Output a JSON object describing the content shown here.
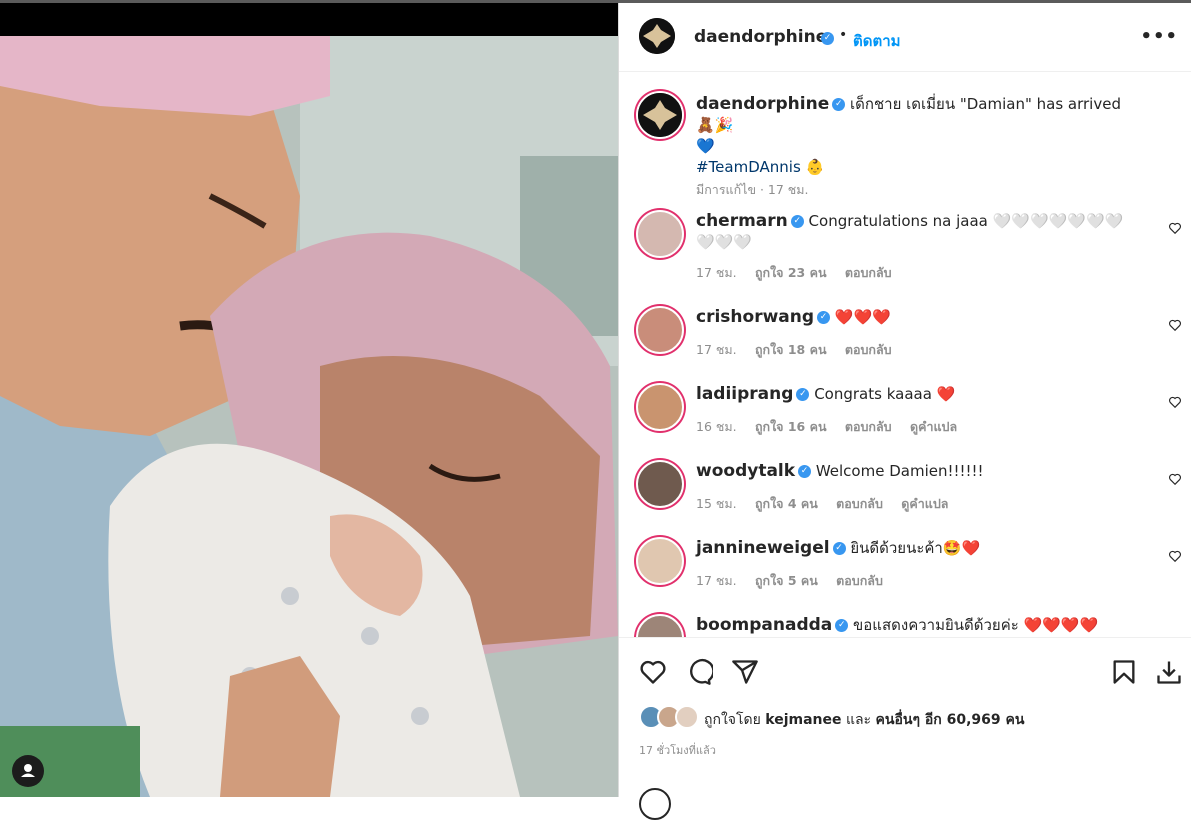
{
  "post": {
    "owner": "daendorphine",
    "follow_label": "ติดตาม",
    "more_label": "•••",
    "dot": "•"
  },
  "caption": {
    "username": "daendorphine",
    "text": "เด็กชาย เดเมี่ยน \"Damian\" has arrived 🧸🎉",
    "text_line2": "💙",
    "hashtag": "#TeamDAnnis",
    "hashtag_emoji": "👶",
    "meta": "มีการแก้ไข · 17 ชม."
  },
  "comments": [
    {
      "username": "chermarn",
      "text": "Congratulations na jaaa 🤍🤍🤍🤍🤍🤍🤍",
      "text2": "🤍🤍🤍",
      "time": "17 ชม.",
      "likes": "ถูกใจ 23 คน",
      "reply": "ตอบกลับ",
      "translate": ""
    },
    {
      "username": "crishorwang",
      "text": "❤️❤️❤️",
      "text2": "",
      "time": "17 ชม.",
      "likes": "ถูกใจ 18 คน",
      "reply": "ตอบกลับ",
      "translate": ""
    },
    {
      "username": "ladiiprang",
      "text": "Congrats kaaaa ❤️",
      "text2": "",
      "time": "16 ชม.",
      "likes": "ถูกใจ 16 คน",
      "reply": "ตอบกลับ",
      "translate": "ดูคำแปล"
    },
    {
      "username": "woodytalk",
      "text": "Welcome Damien!!!!!!",
      "text2": "",
      "time": "15 ชม.",
      "likes": "ถูกใจ 4 คน",
      "reply": "ตอบกลับ",
      "translate": "ดูคำแปล"
    },
    {
      "username": "jannineweigel",
      "text": "ยินดีด้วยนะค้า🤩❤️",
      "text2": "",
      "time": "17 ชม.",
      "likes": "ถูกใจ 5 คน",
      "reply": "ตอบกลับ",
      "translate": ""
    },
    {
      "username": "boompanadda",
      "text": "ขอแสดงความยินดีด้วยค่ะ ❤️❤️❤️❤️",
      "text2": "",
      "time": "",
      "likes": "",
      "reply": "",
      "translate": ""
    }
  ],
  "liked_by": {
    "prefix": "ถูกใจโดย",
    "user": "kejmanee",
    "middle": "และ",
    "others": "คนอื่นๆ อีก 60,969 คน"
  },
  "posted_ago": "17 ชั่วโมงที่แล้ว",
  "colors": {
    "link_blue": "#0095f6",
    "verified_blue": "#3897f0",
    "story_ring": "#e1306c",
    "heart_red": "#ed1c24"
  },
  "icons": [
    "heart-icon",
    "comment-icon",
    "share-icon",
    "bookmark-icon",
    "download-icon",
    "more-icon",
    "verified-icon",
    "user-tag-icon"
  ]
}
